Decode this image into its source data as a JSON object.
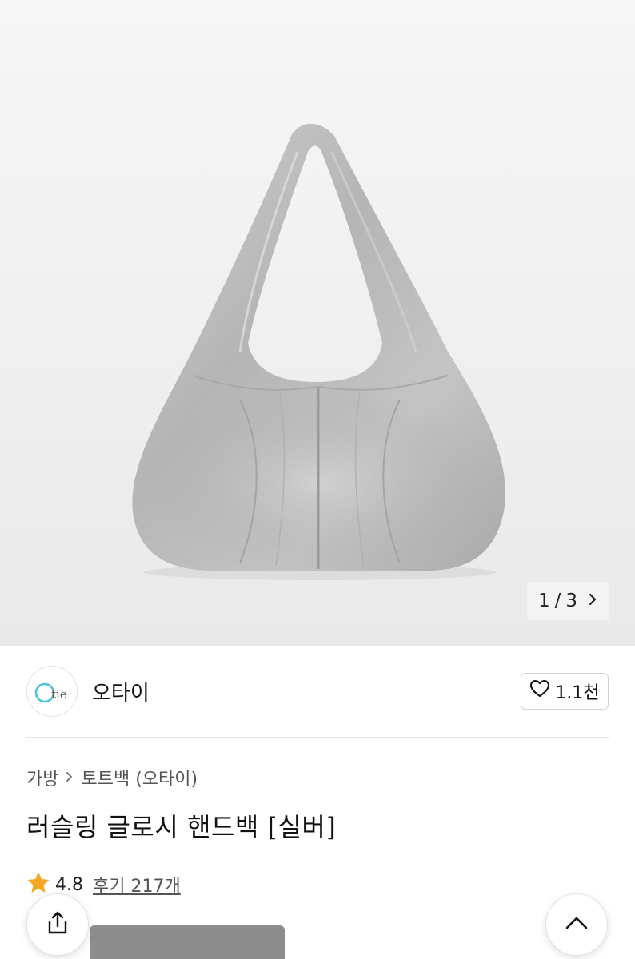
{
  "gallery": {
    "current_page": "1",
    "separator": "/",
    "total_pages": "3",
    "next_icon": "chevron-right-icon"
  },
  "seller": {
    "avatar_logo_text": "Otie",
    "name": "오타이",
    "follow_icon": "heart-outline-icon",
    "follow_count": "1.1천"
  },
  "breadcrumb": {
    "category": "가방",
    "separator_icon": "chevron-right-icon",
    "subcategory": "토트백 (오타이)"
  },
  "product": {
    "title": "러슬링 글로시 핸드백 [실버]",
    "rating_icon": "star-icon",
    "rating": "4.8",
    "reviews": "후기 217개"
  },
  "floating": {
    "share_icon": "share-icon",
    "scroll_top_icon": "chevron-up-icon"
  },
  "colors": {
    "star": "#f5a623",
    "avatar_accent": "#4cc3d9",
    "bag_silver": "#b8b8b8"
  }
}
